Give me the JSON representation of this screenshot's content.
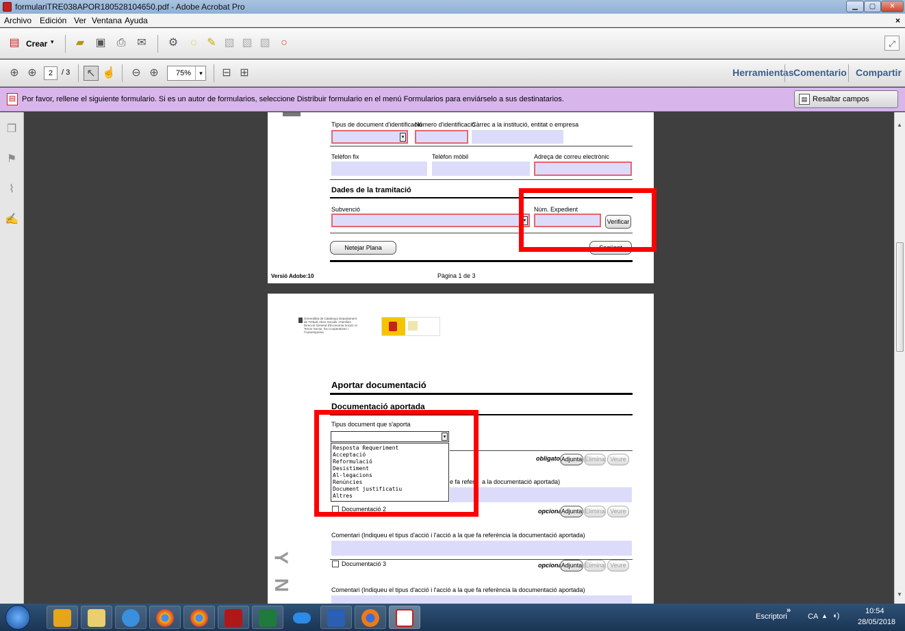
{
  "window": {
    "title": "formulariTRE038APOR180528104650.pdf - Adobe Acrobat Pro"
  },
  "menu": [
    "Archivo",
    "Edición",
    "Ver",
    "Ventana",
    "Ayuda"
  ],
  "toolbar": {
    "create_label": "Crear",
    "page_current": "2",
    "page_total": "/ 3",
    "zoom": "75%"
  },
  "right_tabs": [
    "Herramientas",
    "Comentario",
    "Compartir"
  ],
  "message_bar": {
    "text": "Por favor, rellene el siguiente formulario. Si es un autor de formularios, seleccione Distribuir formulario en el menú Formularios para enviárselo a sus destinatarios.",
    "highlight_button": "Resaltar campos existentes"
  },
  "page1": {
    "label_doc_type": "Tipus de document d'identificació",
    "label_id_number": "Número d'identificació",
    "label_position": "Càrrec a la institució, entitat o empresa",
    "label_phone": "Telèfon fix",
    "label_mobile": "Telèfon mòbil",
    "label_email": "Adreça de correu electrònic",
    "section_processing": "Dades de la tramitació",
    "label_subsidy": "Subvenció",
    "label_file_num": "Núm. Expedient",
    "verify_button": "Verificar",
    "clear_button": "Netejar Plana",
    "next_button": "Següent",
    "version": "Versió Adobe:10",
    "page_info": "Pàgina 1 de 3"
  },
  "page2": {
    "logo_left_text": "Generalitat de Catalunya Departament de Treball, Afers Socials i Famílies Direcció General d'Economia Social, el Tercer Sector, les Cooperatives i l'Autoempresa",
    "section_title": "Aportar documentació",
    "subsection": "Documentació aportada",
    "label_doc_type": "Tipus document que s'aporta",
    "dropdown_options": [
      "Resposta Requeriment",
      "Acceptació",
      "Reformulació",
      "Desistiment",
      "Al·legacions",
      "Renúncies",
      "Document justificatiu",
      "Altres"
    ],
    "required_label": "obligatori",
    "optional_label": "opcional",
    "attach_button": "Adjunta",
    "delete_button": "Elimina",
    "view_button": "Veure",
    "comment_fragment_pre": "e fa referè",
    "comment_fragment_post": "a la documentació aportada)",
    "doc2_label": "Documentació 2",
    "doc3_label": "Documentació 3",
    "comment_label": "Comentari (Indiqueu el tipus d'acció i l'acció a la que fa referència la documentació aportada)",
    "side_letters": [
      "Y",
      "N"
    ]
  },
  "taskbar": {
    "lang": "CA",
    "desktop": "Escriptori",
    "time": "10:54",
    "date": "28/05/2018"
  }
}
